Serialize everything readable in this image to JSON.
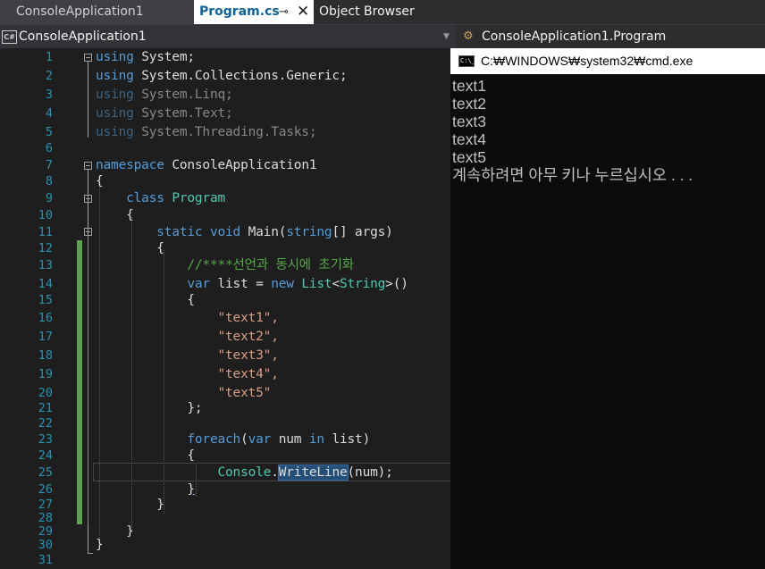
{
  "tabs": {
    "project": "ConsoleApplication1",
    "file": "Program.cs",
    "pin": "⊸",
    "close": "✕",
    "browser": "Object Browser"
  },
  "navbar": {
    "project_icon": "C#",
    "project": "ConsoleApplication1",
    "class_path": "ConsoleApplication1.Program"
  },
  "editor": {
    "line_numbers": [
      "1",
      "2",
      "3",
      "4",
      "5",
      "6",
      "7",
      "8",
      "9",
      "10",
      "11",
      "12",
      "13",
      "14",
      "15",
      "16",
      "17",
      "18",
      "19",
      "20",
      "21",
      "22",
      "23",
      "24",
      "25",
      "26",
      "27",
      "28",
      "29",
      "30",
      "31"
    ],
    "tokens": {
      "using": "using",
      "namespace": "namespace",
      "class": "class",
      "static": "static",
      "void": "void",
      "string": "string",
      "var": "var",
      "new": "new",
      "foreach": "foreach",
      "in": "in",
      "List": "List",
      "String": "String",
      "Program": "Program",
      "Console": "Console"
    },
    "l1": "System;",
    "l2": "System.Collections.Generic;",
    "l3": "System.Linq;",
    "l4": "System.Text;",
    "l5": "System.Threading.Tasks;",
    "l7": "ConsoleApplication1",
    "brace_open": "{",
    "brace_close": "}",
    "l11_main": "Main(",
    "l11_rest": "[] args)",
    "l13_comment": "//****선언과 동시에 초기화",
    "l14_a": "list = ",
    "l14_lt": "<",
    "l14_gt": ">()",
    "l16": "\"text1\",",
    "l17": "\"text2\",",
    "l18": "\"text3\",",
    "l19": "\"text4\",",
    "l20": "\"text5\"",
    "l21": "};",
    "l23_a": "(",
    "l23_b": " num ",
    "l23_c": " list)",
    "l25_dot": ".",
    "l25_method": "WriteLine",
    "l25_rest": "(num);"
  },
  "console": {
    "title": "C:₩WINDOWS₩system32₩cmd.exe",
    "icon_text": "C:\\_",
    "output": [
      "text1",
      "text2",
      "text3",
      "text4",
      "text5",
      "계속하려면 아무 키나 누르십시오 . . ."
    ]
  },
  "colors": {
    "keyword": "#569cd6",
    "type": "#4ec9b0",
    "string": "#d69d85",
    "comment": "#57a64a",
    "line_number": "#2b91af",
    "background": "#1e1e1e"
  }
}
